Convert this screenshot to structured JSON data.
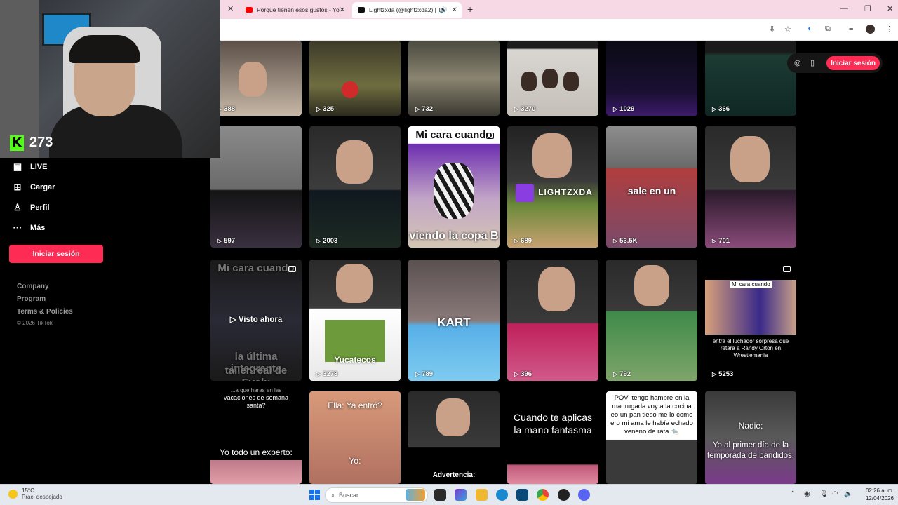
{
  "browser": {
    "tabs": [
      {
        "title": "Porque tienen esos gustos - Yo",
        "favicon": "youtube-icon"
      },
      {
        "title": "Lightzxda (@lightzxda2) | Ti",
        "favicon": "tiktok-icon",
        "active": true
      }
    ]
  },
  "stream_overlay": {
    "viewer_count": "273",
    "platform_logo": "K"
  },
  "sidebar": {
    "nav": [
      {
        "label": "LIVE",
        "icon": "live-icon"
      },
      {
        "label": "Cargar",
        "icon": "upload-icon"
      },
      {
        "label": "Perfil",
        "icon": "profile-icon"
      },
      {
        "label": "Más",
        "icon": "more-icon"
      }
    ],
    "login_label": "Iniciar sesión",
    "footer_links": [
      "Company",
      "Program",
      "Terms & Policies"
    ],
    "copyright": "© 2026 TikTok"
  },
  "topbar": {
    "login_label": "Iniciar sesión"
  },
  "videos": {
    "row1": [
      "388",
      "325",
      "732",
      "3270",
      "1029",
      "366"
    ],
    "row2": [
      "597",
      "2003",
      "",
      "689",
      "53.5K",
      "701"
    ],
    "row3": [
      "Visto ahora",
      "3278",
      "789",
      "396",
      "792",
      "5253"
    ]
  },
  "captions": {
    "mi_cara_cuando": "Mi cara cuando",
    "viendo_copa": "viendo la copa B",
    "lightzxda": "LIGHTZXDA",
    "sale_en_un": "sale en un",
    "mi_cara_cuando_2": "Mi cara cuando",
    "ultima_integrante": "la última integrante",
    "taller_real": "taller real de Evolu",
    "yucatecos": "Yucatecos",
    "kart": "KART",
    "mi_cara_cuando_small": "Mi cara cuando",
    "luchador": "entra el luchador sorpresa que retará a Randy Orton en Wrestlemania",
    "vacaciones_top": "...a que haras en las",
    "vacaciones": "vacaciones de semana santa?",
    "yo_todo_experto": "Yo todo un experto:",
    "ella_ya_entro": "Ella: Ya entró?",
    "yo": "Yo:",
    "advertencia": "Advertencia:",
    "cuando_aplicas": "Cuando te aplicas la mano fantasma",
    "pov": "POV: tengo hambre en la madrugada voy a la cocina eo un pan tieso me lo come ero mi ama le había echado veneno de rata 🐀",
    "nadie": "Nadie:",
    "primer_dia": "Yo al primer día de la temporada de bandidos:"
  },
  "taskbar": {
    "temperature": "15°C",
    "weather": "Prac. despejado",
    "search_placeholder": "Buscar",
    "time": "02:26 a. m.",
    "date": "12/04/2026"
  },
  "colors": {
    "accent": "#fe2c55",
    "kick_green": "#53fc18",
    "tab_bar": "#f7d9e5"
  }
}
